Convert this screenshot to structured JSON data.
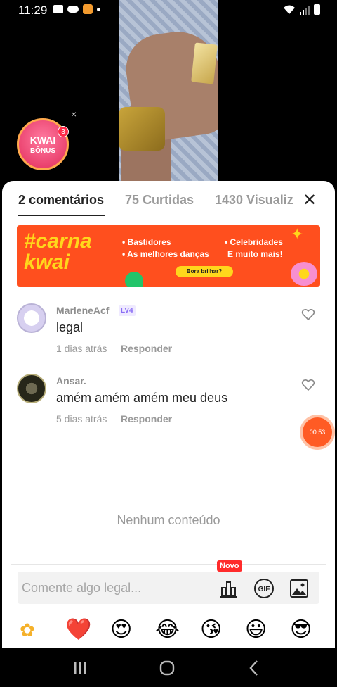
{
  "status_bar": {
    "time": "11:29"
  },
  "kwai_bonus": {
    "title": "KWAI",
    "subtitle": "BÔNUS",
    "badge_count": "3",
    "close_glyph": "×"
  },
  "tabs": [
    {
      "label": "2 comentários",
      "active": true
    },
    {
      "label": "75 Curtidas",
      "active": false
    },
    {
      "label": "1430 Visualiz",
      "active": false
    }
  ],
  "close_glyph": "✕",
  "banner": {
    "title_line1": "#carna",
    "title_line2": "kwai",
    "left_items": [
      "• Bastidores",
      "• As melhores danças"
    ],
    "right_items": [
      "• Celebridades",
      "E muito mais!"
    ],
    "button_label": "Bora brilhar?"
  },
  "comments": [
    {
      "username": "MarleneAcf",
      "level": "LV4",
      "text": "legal",
      "time": "1 dias atrás",
      "reply_label": "Responder"
    },
    {
      "username": "Ansar.",
      "text": "amém amém amém meu deus",
      "time": "5 dias atrás",
      "reply_label": "Responder"
    }
  ],
  "timer": "00:53",
  "empty_message": "Nenhum conteúdo",
  "input": {
    "placeholder": "Comente algo legal...",
    "new_badge": "Novo",
    "gif_label": "GIF"
  },
  "emojis": [
    "kwai-sticker",
    "❤️",
    "😍",
    "😂",
    "😘",
    "😃",
    "😎"
  ],
  "colors": {
    "accent": "#ff4f1e",
    "timer": "#ff5b24",
    "badge": "#ff2b2b",
    "level": "#8b6ef5"
  }
}
